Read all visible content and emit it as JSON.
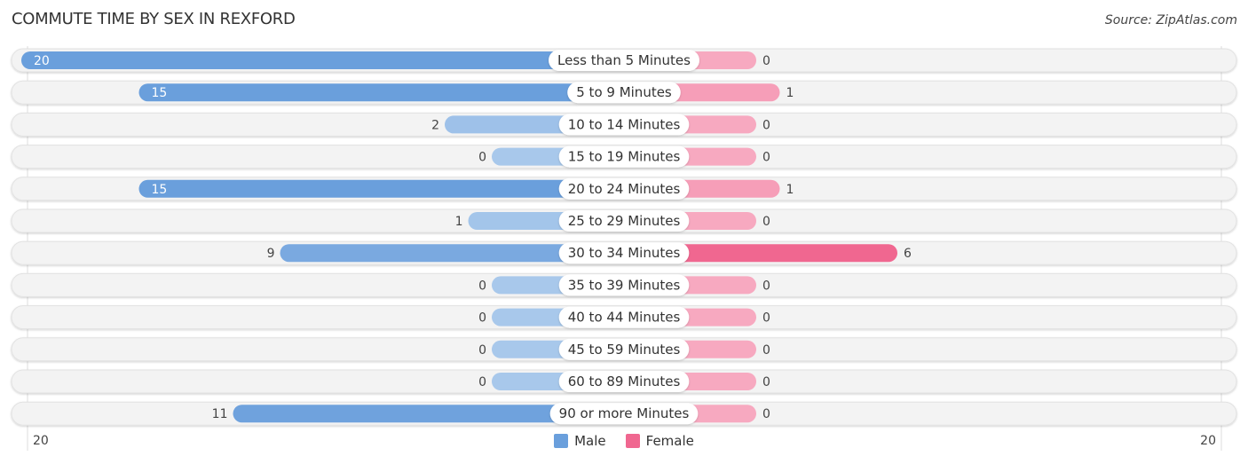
{
  "header": {
    "title": "COMMUTE TIME BY SEX IN REXFORD",
    "source": "Source: ZipAtlas.com"
  },
  "chart_data": {
    "type": "bar",
    "orientation": "horizontal-diverging",
    "title": "COMMUTE TIME BY SEX IN REXFORD",
    "categories": [
      "Less than 5 Minutes",
      "5 to 9 Minutes",
      "10 to 14 Minutes",
      "15 to 19 Minutes",
      "20 to 24 Minutes",
      "25 to 29 Minutes",
      "30 to 34 Minutes",
      "35 to 39 Minutes",
      "40 to 44 Minutes",
      "45 to 59 Minutes",
      "60 to 89 Minutes",
      "90 or more Minutes"
    ],
    "series": [
      {
        "name": "Male",
        "color": "#6a9fdc",
        "values": [
          20,
          15,
          2,
          0,
          15,
          1,
          9,
          0,
          0,
          0,
          0,
          11
        ]
      },
      {
        "name": "Female",
        "color": "#f06790",
        "values": [
          0,
          1,
          0,
          0,
          1,
          0,
          6,
          0,
          0,
          0,
          0,
          0
        ]
      }
    ],
    "axis": {
      "left_max_label": "20",
      "right_max_label": "20",
      "max": 20
    },
    "legend": {
      "position": "bottom-center",
      "entries": [
        "Male",
        "Female"
      ]
    },
    "grid": false
  },
  "colors": {
    "male_strong": "#6a9fdc",
    "male_light": "#a8c8eb",
    "female_strong": "#f06790",
    "female_light": "#f7a9c0",
    "row_bg": "#f3f3f3"
  }
}
